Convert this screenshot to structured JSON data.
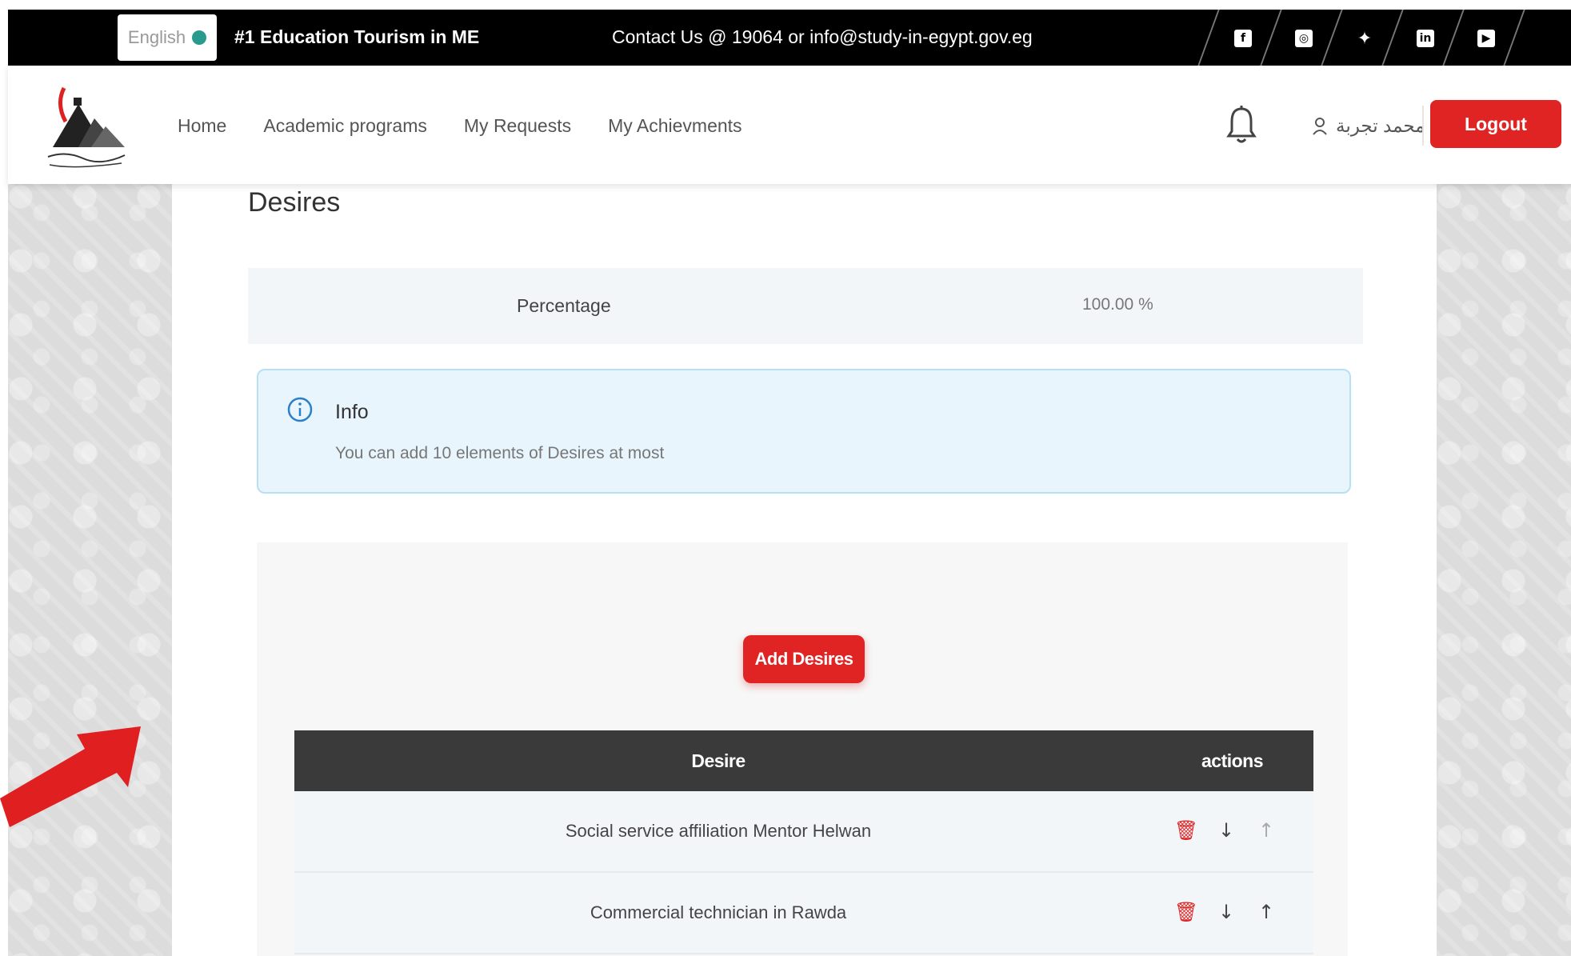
{
  "topbar": {
    "language": "English",
    "tagline": "#1 Education Tourism in ME",
    "contact": "Contact Us @ 19064 or info@study-in-egypt.gov.eg",
    "social_icons": [
      "facebook-icon",
      "instagram-icon",
      "twitter-icon",
      "linkedin-icon",
      "youtube-icon"
    ]
  },
  "header": {
    "nav": [
      "Home",
      "Academic programs",
      "My Requests",
      "My Achievments"
    ],
    "user_name": "محمد تجربة",
    "logout": "Logout"
  },
  "main": {
    "title": "Desires",
    "percentage_label": "Percentage",
    "percentage_value": "100.00 %",
    "info": {
      "title": "Info",
      "text": "You can add 10 elements of Desires at most"
    },
    "add_button": "Add Desires",
    "table": {
      "headers": [
        "Desire",
        "actions"
      ],
      "rows": [
        {
          "desire": "Social service affiliation Mentor Helwan"
        },
        {
          "desire": "Commercial technician in Rawda"
        }
      ]
    }
  },
  "colors": {
    "accent": "#e02424",
    "topbar": "#000000",
    "info_bg": "#e8f5fd"
  }
}
